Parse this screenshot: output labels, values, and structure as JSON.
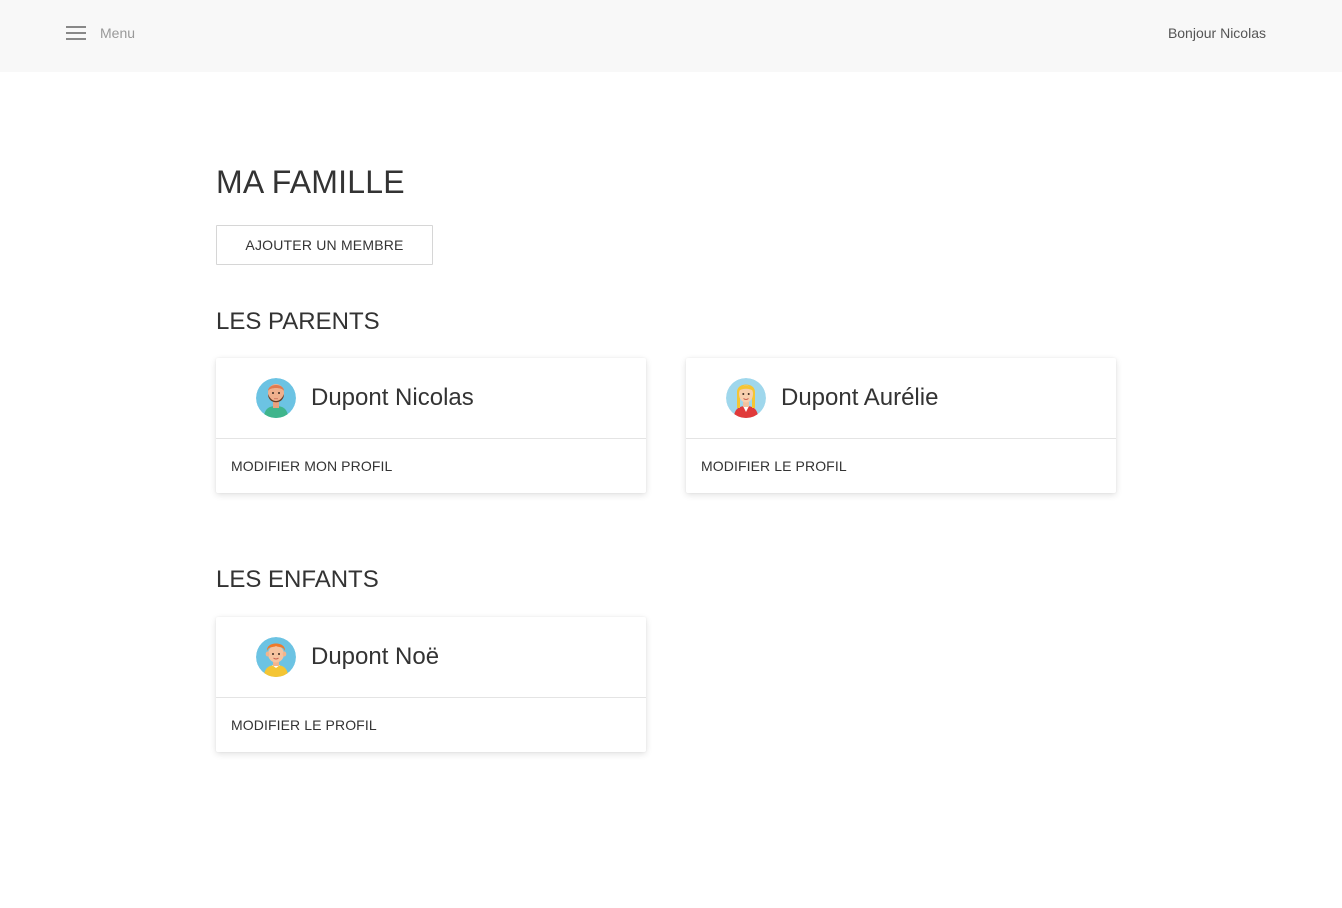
{
  "header": {
    "menu_label": "Menu",
    "greeting": "Bonjour Nicolas"
  },
  "page": {
    "title": "MA FAMILLE",
    "add_member_label": "AJOUTER UN MEMBRE"
  },
  "parents": {
    "title": "LES PARENTS",
    "members": [
      {
        "name": "Dupont Nicolas",
        "action": "MODIFIER MON PROFIL",
        "avatar_icon": "bearded-man-avatar-icon"
      },
      {
        "name": "Dupont Aurélie",
        "action": "MODIFIER LE PROFIL",
        "avatar_icon": "blonde-woman-avatar-icon"
      }
    ]
  },
  "children": {
    "title": "LES ENFANTS",
    "members": [
      {
        "name": "Dupont Noë",
        "action": "MODIFIER LE PROFIL",
        "avatar_icon": "redhead-child-avatar-icon"
      }
    ]
  },
  "colors": {
    "header_bg": "#f8f8f8",
    "text": "#333333",
    "muted": "#999999"
  }
}
